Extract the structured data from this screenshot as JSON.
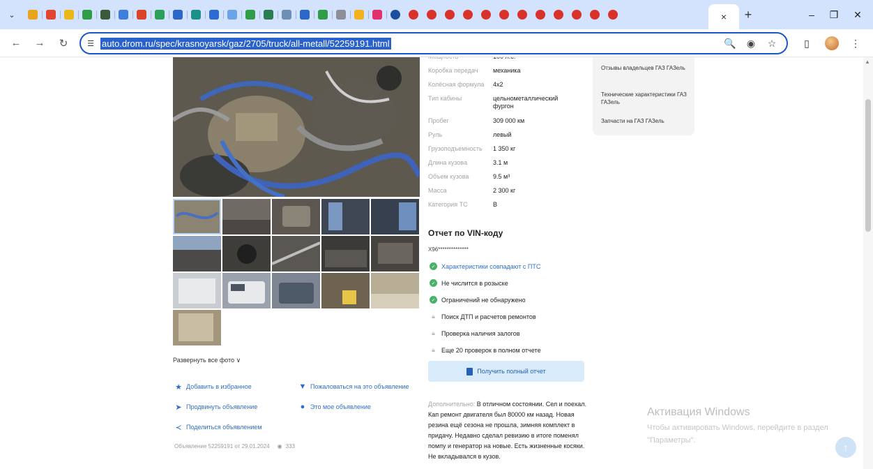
{
  "browser": {
    "url": "auto.drom.ru/spec/krasnoyarsk/gaz/2705/truck/all-metall/52259191.html",
    "tab_favicons": [
      {
        "name": "favicon-multicolor",
        "color": "#e9a41c"
      },
      {
        "name": "favicon-mail",
        "color": "#e0452f"
      },
      {
        "name": "favicon-yellow",
        "color": "#e9b816"
      },
      {
        "name": "favicon-green-grid",
        "color": "#2f9c48"
      },
      {
        "name": "favicon-dark",
        "color": "#3b5a3a"
      },
      {
        "name": "favicon-chrome",
        "color": "#3d7fd9"
      },
      {
        "name": "favicon-red",
        "color": "#d9442b"
      },
      {
        "name": "favicon-green",
        "color": "#2aa05a"
      },
      {
        "name": "favicon-blue-doc",
        "color": "#2a67c9"
      },
      {
        "name": "favicon-teal",
        "color": "#1f8f8a"
      },
      {
        "name": "favicon-circle-blue",
        "color": "#2d6bd2"
      },
      {
        "name": "favicon-doc-light",
        "color": "#6aa3e8"
      },
      {
        "name": "favicon-check",
        "color": "#2f9c48"
      },
      {
        "name": "favicon-shield",
        "color": "#2a7d4f"
      },
      {
        "name": "favicon-flower",
        "color": "#6d8fb3"
      },
      {
        "name": "favicon-blue-grid",
        "color": "#2a67c9"
      },
      {
        "name": "favicon-green-grid-2",
        "color": "#2f9c48"
      },
      {
        "name": "favicon-gray",
        "color": "#8a8f98"
      },
      {
        "name": "favicon-sun",
        "color": "#f2b21d"
      },
      {
        "name": "favicon-pink",
        "color": "#e2306c"
      },
      {
        "name": "favicon-mail-blue",
        "color": "#1b4f9e"
      },
      {
        "name": "favicon-drom-1",
        "color": "#d8322a"
      },
      {
        "name": "favicon-drom-2",
        "color": "#d8322a"
      },
      {
        "name": "favicon-drom-3",
        "color": "#d8322a"
      },
      {
        "name": "favicon-drom-4",
        "color": "#d8322a"
      },
      {
        "name": "favicon-drom-5",
        "color": "#d8322a"
      },
      {
        "name": "favicon-drom-6",
        "color": "#d8322a"
      },
      {
        "name": "favicon-drom-7",
        "color": "#d8322a"
      },
      {
        "name": "favicon-drom-8",
        "color": "#d8322a"
      },
      {
        "name": "favicon-drom-9",
        "color": "#d8322a"
      },
      {
        "name": "favicon-drom-10",
        "color": "#d8322a"
      },
      {
        "name": "favicon-drom-11",
        "color": "#d8322a"
      },
      {
        "name": "favicon-drom-12",
        "color": "#d8322a"
      }
    ],
    "tab_close": "×",
    "new_tab": "+",
    "minimize": "–",
    "restore": "❐",
    "close": "✕",
    "back": "←",
    "forward": "→",
    "reload": "↻"
  },
  "specs": [
    {
      "label": "Мощность",
      "value": "100 л.с."
    },
    {
      "label": "Коробка передач",
      "value": "механика"
    },
    {
      "label": "Колёсная формула",
      "value": "4x2"
    },
    {
      "label": "Тип кабины",
      "value": "цельнометаллический фургон"
    },
    {
      "label": "Пробег",
      "value": "309 000 км"
    },
    {
      "label": "Руль",
      "value": "левый"
    },
    {
      "label": "Грузоподъемность",
      "value": "1 350 кг"
    },
    {
      "label": "Длина кузова",
      "value": "3.1 м"
    },
    {
      "label": "Объем кузова",
      "value": "9.5 м³"
    },
    {
      "label": "Масса",
      "value": "2 300 кг"
    },
    {
      "label": "Категория ТС",
      "value": "B"
    }
  ],
  "vin": {
    "title": "Отчет по VIN-коду",
    "number": "X96**************",
    "checks": [
      {
        "text": "Характеристики совпадают с ПТС",
        "status": "ok"
      },
      {
        "text": "Не числится в розыске",
        "status": "ok"
      },
      {
        "text": "Ограничений не обнаружено",
        "status": "ok"
      },
      {
        "text": "Поиск ДТП и расчетов ремонтов",
        "status": "locked"
      },
      {
        "text": "Проверка наличия залогов",
        "status": "locked"
      },
      {
        "text": "Еще 20 проверок в полном отчете",
        "status": "locked"
      }
    ],
    "button": "Получить полный отчет"
  },
  "photos": {
    "expand": "Развернуть все фото ∨"
  },
  "actions": {
    "favorite": "Добавить в избранное",
    "complain": "Пожаловаться на это объявление",
    "promote": "Продвинуть объявление",
    "mine": "Это мое объявление",
    "share": "Поделиться объявлением"
  },
  "meta": {
    "listing": "Объявление 52259191 от 29.01.2024",
    "views": "333"
  },
  "description": {
    "label": "Дополнительно:",
    "text": "В отличном состоянии. Сел и поехал. Кап ремонт двигателя был 80000 км назад. Новая резина ещё сезона не прошла, зимняя комплект в придачу. Недавно сделал ревизию в итоге поменял помпу и генератор на новые. Есть жизненные косяки. Не вкладывался в кузов."
  },
  "sidebar": {
    "links": [
      "Отзывы владельцев ГАЗ ГАЗель",
      "Технические характеристики ГАЗ ГАЗель",
      "Запчасти на ГАЗ ГАЗель"
    ]
  },
  "watermark": {
    "title": "Активация Windows",
    "subtitle": "Чтобы активировать Windows, перейдите в раздел \"Параметры\"."
  }
}
